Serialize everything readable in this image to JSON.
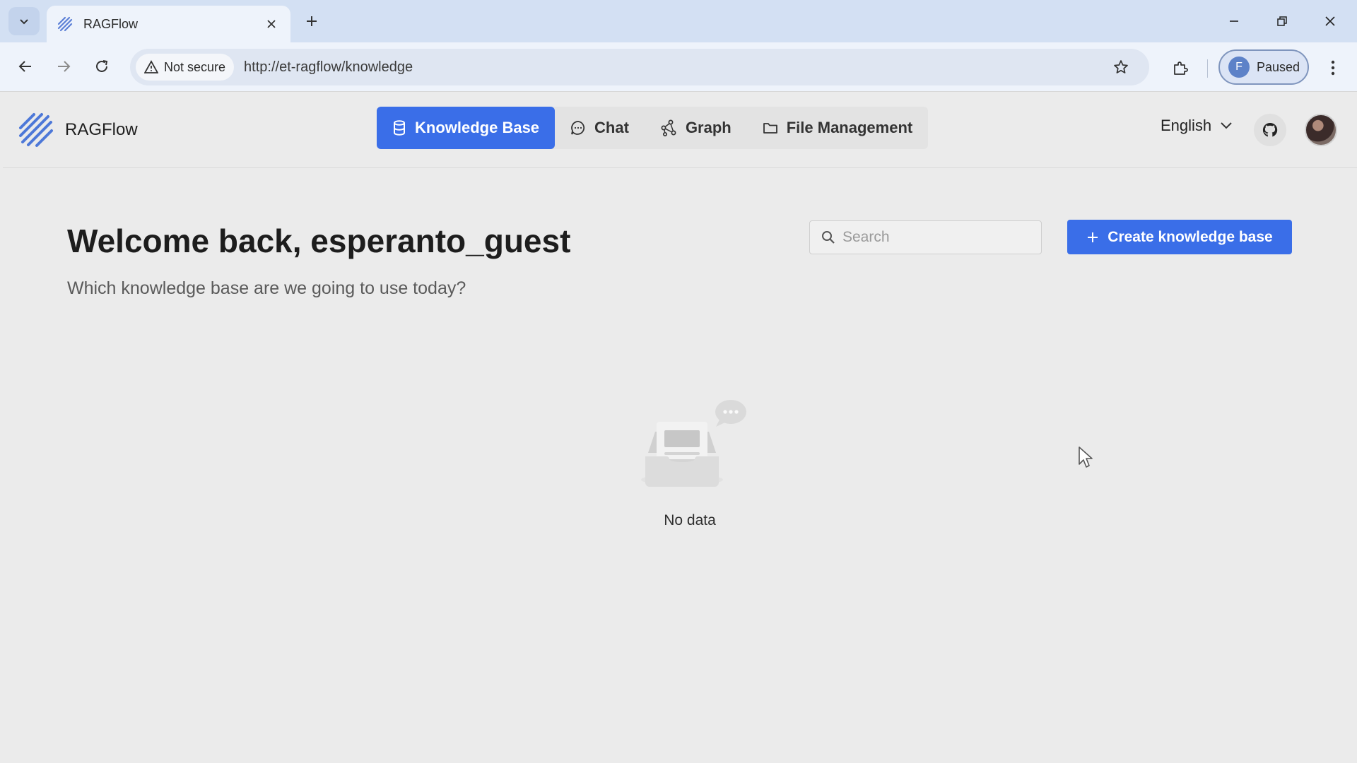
{
  "browser": {
    "tab_title": "RAGFlow",
    "security_label": "Not secure",
    "url": "http://et-ragflow/knowledge",
    "profile_initial": "F",
    "profile_status": "Paused"
  },
  "app": {
    "brand": "RAGFlow",
    "nav": [
      {
        "label": "Knowledge Base",
        "icon": "database-icon",
        "active": true
      },
      {
        "label": "Chat",
        "icon": "chat-bubble-icon",
        "active": false
      },
      {
        "label": "Graph",
        "icon": "graph-nodes-icon",
        "active": false
      },
      {
        "label": "File Management",
        "icon": "folder-icon",
        "active": false
      }
    ],
    "language": "English",
    "accent_color": "#3a6ee8"
  },
  "main": {
    "welcome": "Welcome back, esperanto_guest",
    "subtitle": "Which knowledge base are we going to use today?",
    "search_placeholder": "Search",
    "create_button": "Create knowledge base",
    "empty_text": "No data"
  }
}
